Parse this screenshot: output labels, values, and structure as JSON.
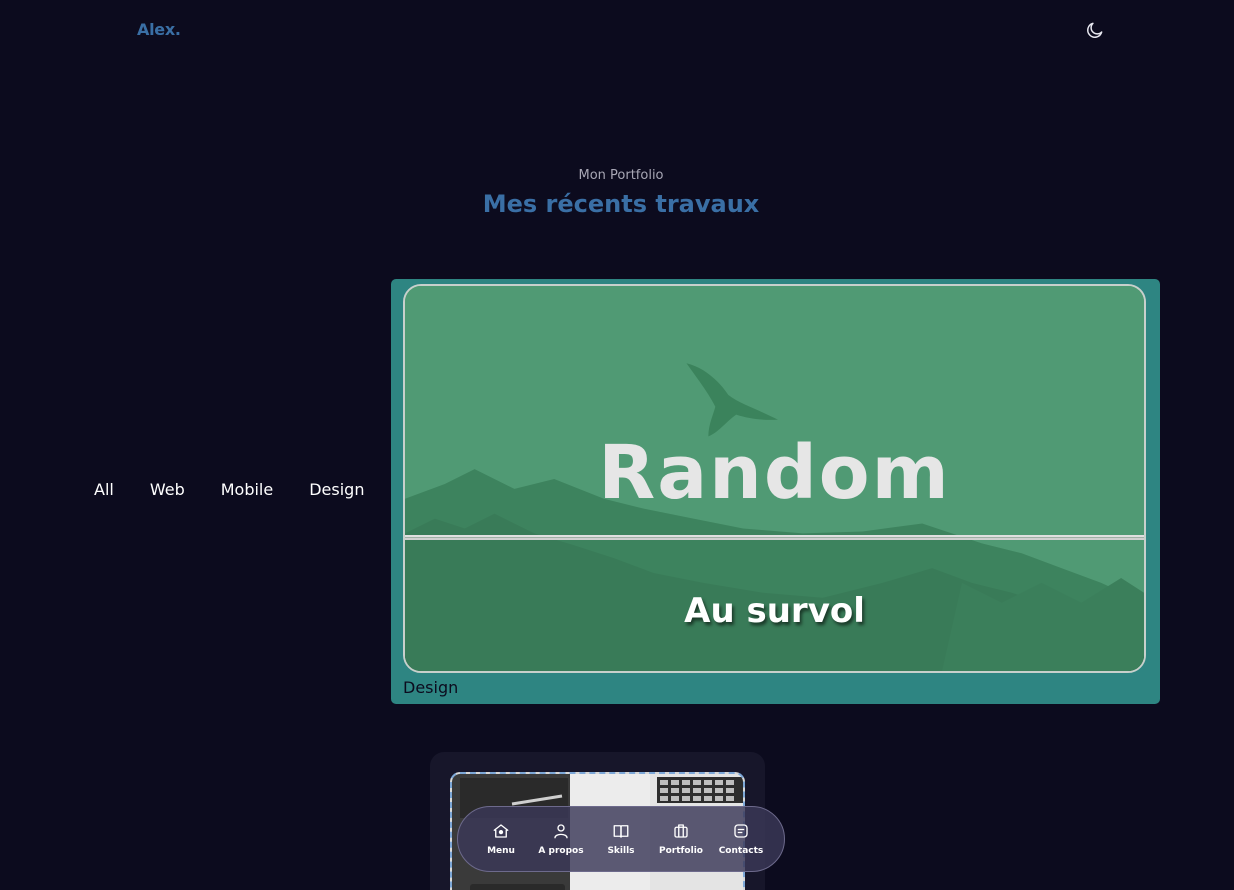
{
  "header": {
    "logo": "Alex.",
    "theme_icon": "moon-icon"
  },
  "section": {
    "subtitle": "Mon Portfolio",
    "title": "Mes récents travaux"
  },
  "filters": [
    {
      "label": "All"
    },
    {
      "label": "Web"
    },
    {
      "label": "Mobile"
    },
    {
      "label": "Design"
    }
  ],
  "project": {
    "image_title": "Random",
    "hover_text": "Au survol",
    "category": "Design"
  },
  "dock": {
    "items": [
      {
        "label": "Menu",
        "icon": "home-icon"
      },
      {
        "label": "A propos",
        "icon": "user-icon"
      },
      {
        "label": "Skills",
        "icon": "book-icon"
      },
      {
        "label": "Portfolio",
        "icon": "briefcase-icon"
      },
      {
        "label": "Contacts",
        "icon": "message-icon"
      }
    ]
  },
  "colors": {
    "background": "#0c0b1e",
    "accent": "#3a6fa5",
    "card": "#2e8582"
  }
}
